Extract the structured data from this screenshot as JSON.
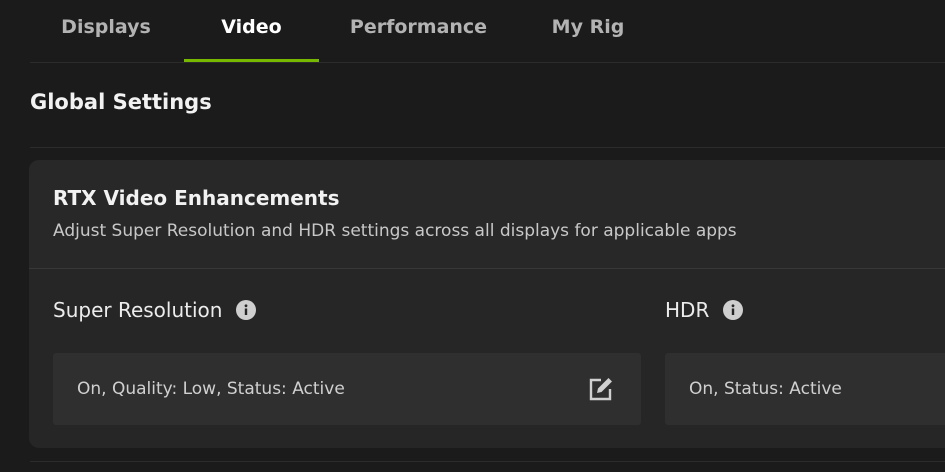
{
  "tabs": [
    {
      "label": "Displays",
      "active": false
    },
    {
      "label": "Video",
      "active": true
    },
    {
      "label": "Performance",
      "active": false
    },
    {
      "label": "My Rig",
      "active": false
    }
  ],
  "colors": {
    "accent": "#76b900",
    "background": "#1b1b1b",
    "card": "#262626",
    "value_box": "#2f2f2f"
  },
  "global_settings": {
    "title": "Global Settings"
  },
  "rtx_card": {
    "title": "RTX Video Enhancements",
    "subtitle": "Adjust Super Resolution and HDR settings across all displays for applicable apps",
    "super_resolution": {
      "label": "Super Resolution",
      "info_icon": "info-icon",
      "value": "On, Quality: Low, Status: Active",
      "edit_icon": "edit-icon"
    },
    "hdr": {
      "label": "HDR",
      "info_icon": "info-icon",
      "value": "On, Status: Active"
    }
  }
}
